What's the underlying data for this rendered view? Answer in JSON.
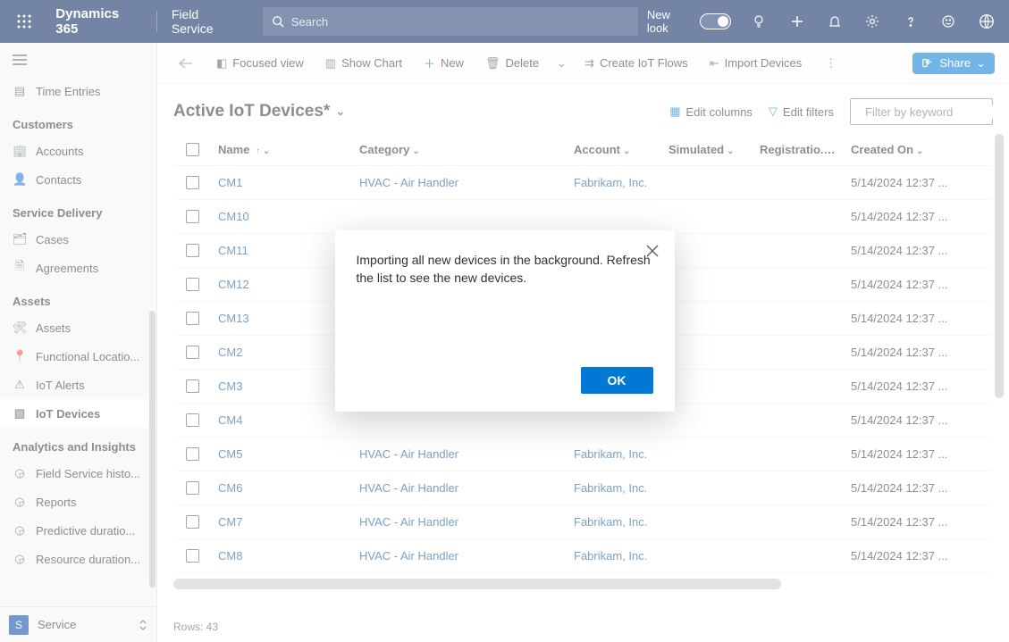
{
  "topbar": {
    "brand": "Dynamics 365",
    "app": "Field Service",
    "search_placeholder": "Search",
    "newlook": "New look"
  },
  "sidebar": {
    "top_item": "Time Entries",
    "groups": [
      {
        "title": "Customers",
        "items": [
          {
            "icon": "building",
            "label": "Accounts"
          },
          {
            "icon": "person",
            "label": "Contacts"
          }
        ]
      },
      {
        "title": "Service Delivery",
        "items": [
          {
            "icon": "briefcase",
            "label": "Cases"
          },
          {
            "icon": "file",
            "label": "Agreements"
          }
        ]
      },
      {
        "title": "Assets",
        "items": [
          {
            "icon": "wrench",
            "label": "Assets"
          },
          {
            "icon": "pin",
            "label": "Functional Locatio..."
          },
          {
            "icon": "alert",
            "label": "IoT Alerts"
          },
          {
            "icon": "chip",
            "label": "IoT Devices",
            "selected": true
          }
        ]
      },
      {
        "title": "Analytics and Insights",
        "items": [
          {
            "icon": "gauge",
            "label": "Field Service histo..."
          },
          {
            "icon": "gauge",
            "label": "Reports"
          },
          {
            "icon": "gauge",
            "label": "Predictive duratio..."
          },
          {
            "icon": "gauge",
            "label": "Resource duration..."
          }
        ]
      }
    ],
    "switcher_badge": "S",
    "switcher_label": "Service"
  },
  "cmdbar": {
    "focused": "Focused view",
    "chart": "Show Chart",
    "new": "New",
    "delete": "Delete",
    "flows": "Create IoT Flows",
    "import": "Import Devices",
    "share": "Share"
  },
  "view": {
    "title": "Active IoT Devices*",
    "edit_columns": "Edit columns",
    "edit_filters": "Edit filters",
    "filter_ph": "Filter by keyword"
  },
  "columns": {
    "name": "Name",
    "category": "Category",
    "account": "Account",
    "simulated": "Simulated",
    "registration": "Registratio...",
    "created": "Created On"
  },
  "rows": [
    {
      "name": "CM1",
      "category": "HVAC - Air Handler",
      "account": "Fabrikam, Inc.",
      "created": "5/14/2024 12:37 ..."
    },
    {
      "name": "CM10",
      "category": "",
      "account": "",
      "created": "5/14/2024 12:37 ..."
    },
    {
      "name": "CM11",
      "category": "",
      "account": "",
      "created": "5/14/2024 12:37 ..."
    },
    {
      "name": "CM12",
      "category": "",
      "account": "",
      "created": "5/14/2024 12:37 ..."
    },
    {
      "name": "CM13",
      "category": "",
      "account": "",
      "created": "5/14/2024 12:37 ..."
    },
    {
      "name": "CM2",
      "category": "",
      "account": "",
      "created": "5/14/2024 12:37 ..."
    },
    {
      "name": "CM3",
      "category": "",
      "account": "",
      "created": "5/14/2024 12:37 ..."
    },
    {
      "name": "CM4",
      "category": "",
      "account": "",
      "created": "5/14/2024 12:37 ..."
    },
    {
      "name": "CM5",
      "category": "HVAC - Air Handler",
      "account": "Fabrikam, Inc.",
      "created": "5/14/2024 12:37 ..."
    },
    {
      "name": "CM6",
      "category": "HVAC - Air Handler",
      "account": "Fabrikam, Inc.",
      "created": "5/14/2024 12:37 ..."
    },
    {
      "name": "CM7",
      "category": "HVAC - Air Handler",
      "account": "Fabrikam, Inc.",
      "created": "5/14/2024 12:37 ..."
    },
    {
      "name": "CM8",
      "category": "HVAC - Air Handler",
      "account": "Fabrikam, Inc.",
      "created": "5/14/2024 12:37 ..."
    }
  ],
  "footer_rows": "Rows: 43",
  "dialog": {
    "message": "Importing all new devices in the background. Refresh the list to see the new devices.",
    "ok": "OK"
  }
}
